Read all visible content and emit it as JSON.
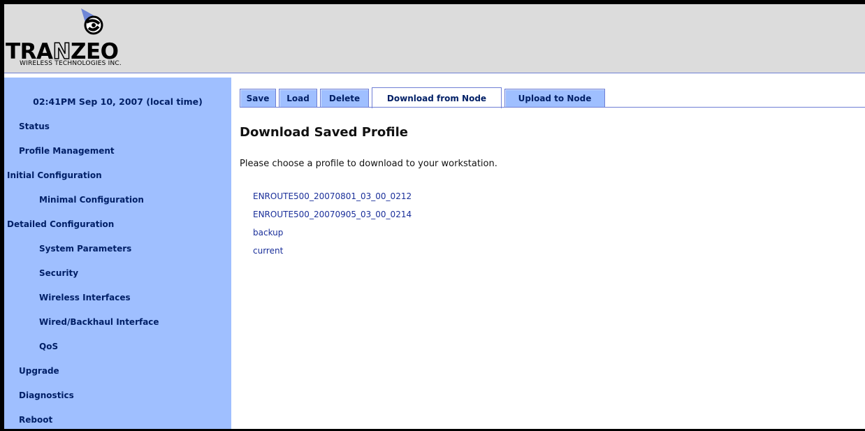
{
  "header": {
    "logo": {
      "wordmark_pre": "TRA",
      "wordmark_hollow": "N",
      "wordmark_post": "ZEO",
      "tagline": "WIRELESS TECHNOLOGIES INC."
    }
  },
  "sidebar": {
    "clock": "02:41PM Sep 10, 2007 (local time)",
    "items": [
      {
        "label": "Status"
      },
      {
        "label": "Profile Management"
      },
      {
        "label": "Initial Configuration"
      },
      {
        "label": "Minimal Configuration"
      },
      {
        "label": "Detailed Configuration"
      },
      {
        "label": "System Parameters"
      },
      {
        "label": "Security"
      },
      {
        "label": "Wireless Interfaces"
      },
      {
        "label": "Wired/Backhaul Interface"
      },
      {
        "label": "QoS"
      },
      {
        "label": "Upgrade"
      },
      {
        "label": "Diagnostics"
      },
      {
        "label": "Reboot"
      }
    ]
  },
  "tabs": [
    {
      "label": "Save"
    },
    {
      "label": "Load"
    },
    {
      "label": "Delete"
    },
    {
      "label": "Download from Node",
      "active": true
    },
    {
      "label": "Upload to Node"
    }
  ],
  "main": {
    "title": "Download Saved Profile",
    "description": "Please choose a profile to download to your workstation.",
    "profiles": [
      "ENROUTE500_20070801_03_00_0212",
      "ENROUTE500_20070905_03_00_0214",
      "backup",
      "current"
    ]
  },
  "colors": {
    "sidebar_bg": "#9fbfff",
    "nav_text": "#001f66",
    "link": "#1a2f9a",
    "header_bg": "#dcdcdc"
  }
}
